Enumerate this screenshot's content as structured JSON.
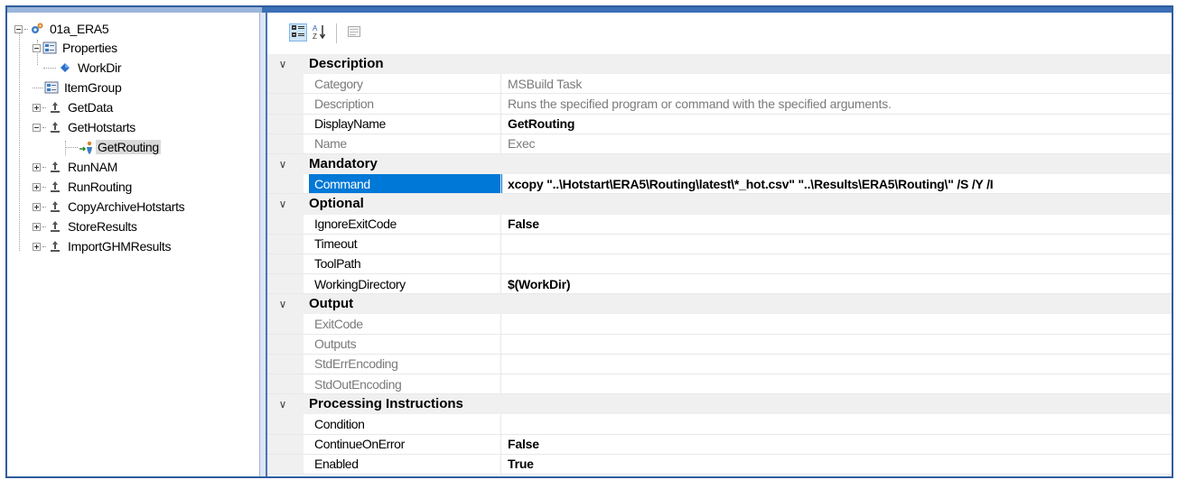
{
  "tree": {
    "root": "01a_ERA5",
    "properties": "Properties",
    "workdir": "WorkDir",
    "itemgroup": "ItemGroup",
    "getdata": "GetData",
    "gethotstarts": "GetHotstarts",
    "getrouting": "GetRouting",
    "runnam": "RunNAM",
    "runrouting": "RunRouting",
    "copyarchive": "CopyArchiveHotstarts",
    "storeresults": "StoreResults",
    "importghm": "ImportGHMResults"
  },
  "grid": {
    "categories": {
      "description": "Description",
      "mandatory": "Mandatory",
      "optional": "Optional",
      "output": "Output",
      "processing": "Processing Instructions"
    },
    "props": {
      "category": {
        "name": "Category",
        "value": "MSBuild Task"
      },
      "description": {
        "name": "Description",
        "value": "Runs the specified program or command with the specified arguments."
      },
      "displayname": {
        "name": "DisplayName",
        "value": "GetRouting"
      },
      "name": {
        "name": "Name",
        "value": "Exec"
      },
      "command": {
        "name": "Command",
        "value": "xcopy \"..\\Hotstart\\ERA5\\Routing\\latest\\*_hot.csv\" \"..\\Results\\ERA5\\Routing\\\" /S /Y /I"
      },
      "ignoreexitcode": {
        "name": "IgnoreExitCode",
        "value": "False"
      },
      "timeout": {
        "name": "Timeout",
        "value": ""
      },
      "toolpath": {
        "name": "ToolPath",
        "value": ""
      },
      "workingdirectory": {
        "name": "WorkingDirectory",
        "value": "$(WorkDir)"
      },
      "exitcode": {
        "name": "ExitCode",
        "value": ""
      },
      "outputs": {
        "name": "Outputs",
        "value": ""
      },
      "stderrencoding": {
        "name": "StdErrEncoding",
        "value": ""
      },
      "stdoutencoding": {
        "name": "StdOutEncoding",
        "value": ""
      },
      "condition": {
        "name": "Condition",
        "value": ""
      },
      "continueonerror": {
        "name": "ContinueOnError",
        "value": "False"
      },
      "enabled": {
        "name": "Enabled",
        "value": "True"
      }
    }
  },
  "icons": {
    "categorized": "categorized-view-icon",
    "alphabetical": "alphabetical-sort-icon",
    "property_pages": "property-pages-icon",
    "project": "project-gear-icon",
    "properties_folder": "properties-icon",
    "property": "property-diamond-icon",
    "itemgroup": "itemgroup-icon",
    "target": "target-icon",
    "task": "task-icon"
  },
  "colors": {
    "frame": "#2f5d9e",
    "selection": "#0078d7",
    "category_band": "#f0f0f0",
    "readonly_text": "#7a7a7a"
  }
}
